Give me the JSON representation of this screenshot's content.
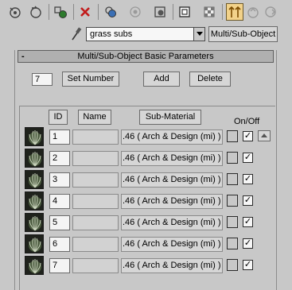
{
  "toolbar": {
    "icons": [
      "get-material-icon",
      "put-to-scene-icon",
      "assign-material-icon",
      "reset-icon",
      "make-copy-icon",
      "make-unique-icon",
      "put-to-library-icon",
      "material-id-channel-icon",
      "show-map-icon",
      "show-end-result-icon",
      "go-to-parent-icon",
      "go-forward-icon"
    ],
    "active_icon": "show-end-result-icon"
  },
  "material": {
    "name": "grass subs",
    "type_label": "Multi/Sub-Object"
  },
  "rollout": {
    "title": "Multi/Sub-Object Basic Parameters",
    "collapse_symbol": "-",
    "count": "7",
    "set_number_label": "Set Number",
    "add_label": "Add",
    "delete_label": "Delete"
  },
  "headers": {
    "id": "ID",
    "name": "Name",
    "sub_material": "Sub-Material",
    "on_off": "On/Off"
  },
  "rows": [
    {
      "id": "1",
      "name": "",
      "material": ".46  ( Arch & Design (mi) )",
      "on": true
    },
    {
      "id": "2",
      "name": "",
      "material": ".46  ( Arch & Design (mi) )",
      "on": true
    },
    {
      "id": "3",
      "name": "",
      "material": ".46  ( Arch & Design (mi) )",
      "on": true
    },
    {
      "id": "4",
      "name": "",
      "material": ".46  ( Arch & Design (mi) )",
      "on": true
    },
    {
      "id": "5",
      "name": "",
      "material": ".46  ( Arch & Design (mi) )",
      "on": true
    },
    {
      "id": "6",
      "name": "",
      "material": ".46  ( Arch & Design (mi) )",
      "on": true
    },
    {
      "id": "7",
      "name": "",
      "material": ".46  ( Arch & Design (mi) )",
      "on": true
    }
  ],
  "check_glyph": "✓"
}
